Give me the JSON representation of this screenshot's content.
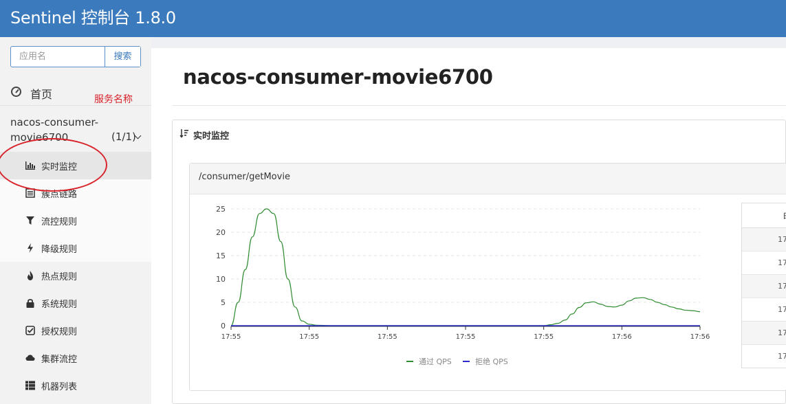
{
  "header": {
    "title": "Sentinel 控制台 1.8.0"
  },
  "sidebar": {
    "search_placeholder": "应用名",
    "search_button": "搜索",
    "home_label": "首页",
    "annotation": "服务名称",
    "app": {
      "name": "nacos-consumer-movie6700",
      "count": "(1/1)"
    },
    "menu": [
      {
        "label": "实时监控",
        "icon": "bar-chart-icon"
      },
      {
        "label": "簇点链路",
        "icon": "list-icon"
      },
      {
        "label": "流控规则",
        "icon": "filter-icon"
      },
      {
        "label": "降级规则",
        "icon": "flash-icon"
      },
      {
        "label": "热点规则",
        "icon": "fire-icon"
      },
      {
        "label": "系统规则",
        "icon": "lock-icon"
      },
      {
        "label": "授权规则",
        "icon": "check-square-icon"
      },
      {
        "label": "集群流控",
        "icon": "cloud-icon"
      },
      {
        "label": "机器列表",
        "icon": "grid-list-icon"
      }
    ]
  },
  "main": {
    "page_title": "nacos-consumer-movie6700",
    "panel_title": "实时监控",
    "card_title": "/consumer/getMovie",
    "table": {
      "header": "时",
      "rows": [
        "17",
        "17",
        "17",
        "17",
        "17",
        "17"
      ]
    }
  },
  "chart_data": {
    "type": "line",
    "x_ticks": [
      "17:55",
      "17:55",
      "17:55",
      "17:55",
      "17:55",
      "17:56",
      "17:56"
    ],
    "y_ticks": [
      0,
      5,
      10,
      15,
      20,
      25
    ],
    "ylim": [
      0,
      26
    ],
    "xlim": [
      0,
      60
    ],
    "series": [
      {
        "name": "通过 QPS",
        "color": "#2e8b2e",
        "points": [
          [
            0,
            0
          ],
          [
            1,
            5
          ],
          [
            2,
            12
          ],
          [
            3,
            19
          ],
          [
            4,
            24
          ],
          [
            5,
            25
          ],
          [
            6,
            24
          ],
          [
            7,
            18
          ],
          [
            8,
            10
          ],
          [
            9,
            4
          ],
          [
            10,
            1
          ],
          [
            11,
            0.3
          ],
          [
            12,
            0.1
          ],
          [
            14,
            0
          ],
          [
            20,
            0
          ],
          [
            30,
            0
          ],
          [
            40,
            0
          ],
          [
            44,
            0
          ],
          [
            45,
            0.2
          ],
          [
            46,
            0.5
          ],
          [
            47,
            1.2
          ],
          [
            48,
            2.5
          ],
          [
            49,
            3.9
          ],
          [
            50,
            4.9
          ],
          [
            51,
            5.1
          ],
          [
            52,
            4.6
          ],
          [
            53,
            4.1
          ],
          [
            54,
            4.0
          ],
          [
            55,
            4.4
          ],
          [
            56,
            5.3
          ],
          [
            57,
            5.9
          ],
          [
            58,
            6.0
          ],
          [
            59,
            5.6
          ],
          [
            60,
            5.0
          ],
          [
            61,
            4.5
          ],
          [
            62,
            4.0
          ],
          [
            63,
            3.6
          ],
          [
            64,
            3.3
          ],
          [
            65,
            3.2
          ],
          [
            66,
            3.0
          ]
        ]
      },
      {
        "name": "拒绝 QPS",
        "color": "#2b2bcc",
        "points": [
          [
            0,
            0
          ],
          [
            66,
            0
          ]
        ]
      }
    ],
    "legend_position": "bottom-center",
    "grid": true
  }
}
